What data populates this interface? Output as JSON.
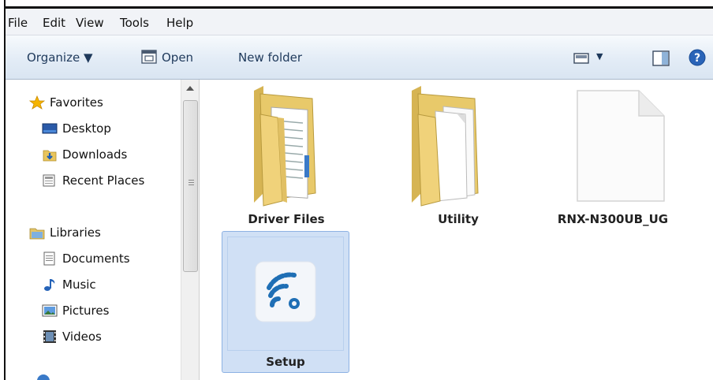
{
  "menu": [
    "File",
    "Edit",
    "View",
    "Tools",
    "Help"
  ],
  "toolbar": {
    "organize": "Organize ▼",
    "open": "Open",
    "new_folder": "New folder",
    "views_arrow": "▼"
  },
  "nav": {
    "favorites": {
      "header": "Favorites",
      "items": [
        "Desktop",
        "Downloads",
        "Recent Places"
      ]
    },
    "libraries": {
      "header": "Libraries",
      "items": [
        "Documents",
        "Music",
        "Pictures",
        "Videos"
      ]
    }
  },
  "files": [
    {
      "name": "Driver Files",
      "icon": "folder-with-documents-icon"
    },
    {
      "name": "Utility",
      "icon": "folder-with-files-icon"
    },
    {
      "name": "RNX-N300UB_UG",
      "icon": "blank-document-icon"
    },
    {
      "name": "Setup",
      "icon": "wifi-app-icon",
      "selected": true
    }
  ],
  "colors": {
    "toolbar_text": "#1e395b",
    "selection_bg": "#d0e0f5",
    "wifi_blue": "#1f6fb5"
  }
}
